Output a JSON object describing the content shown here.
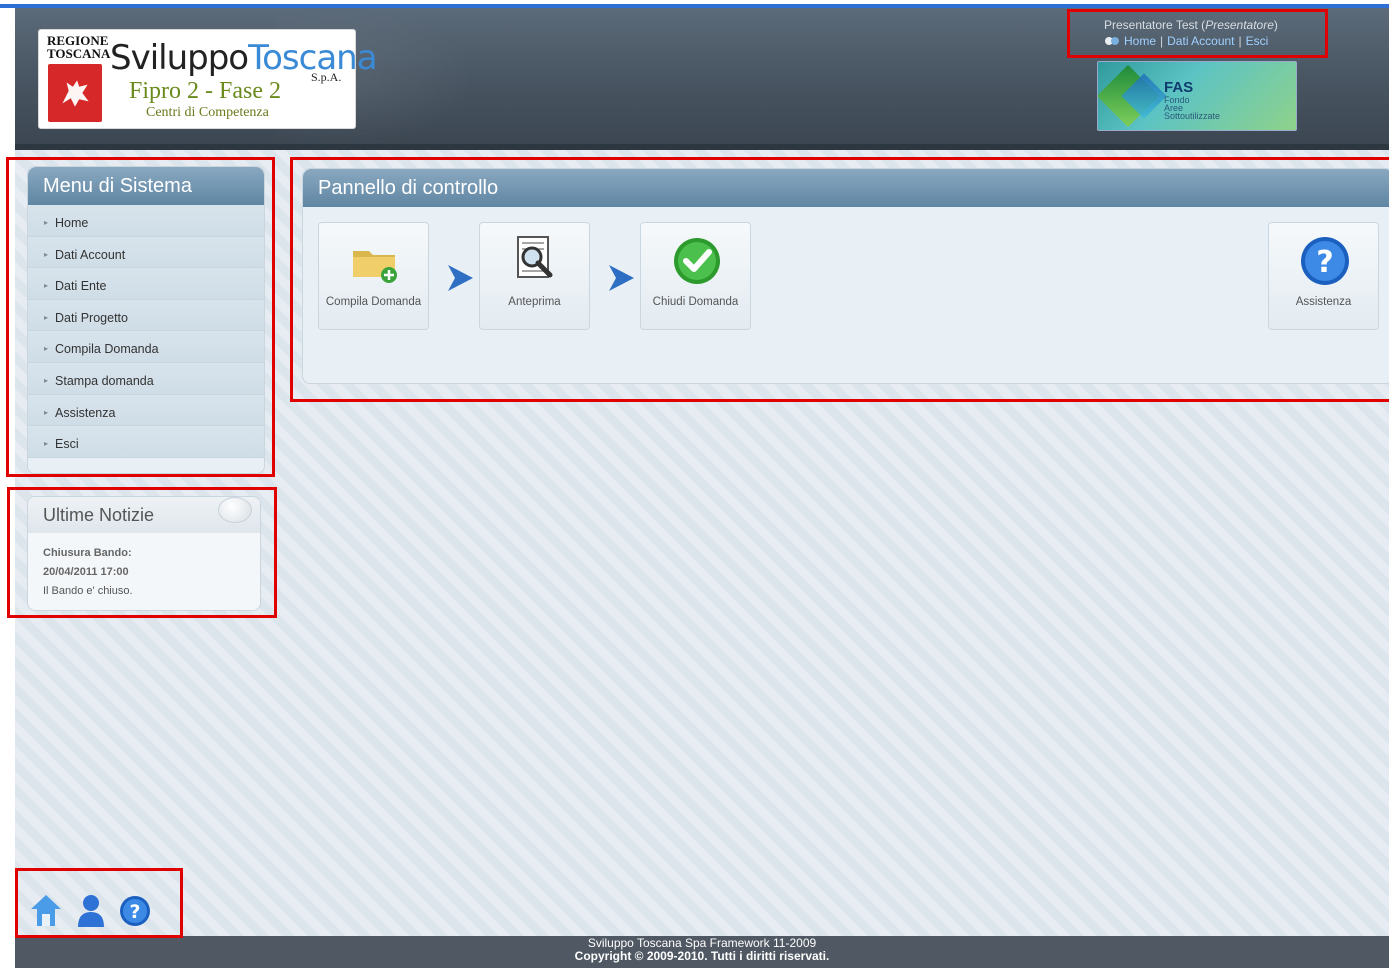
{
  "header": {
    "logo": {
      "region_line1": "REGIONE",
      "region_line2": "TOSCANA",
      "brand_part1": "Sviluppo",
      "brand_part2": "Toscana",
      "brand_suffix": "S.p.A.",
      "project": "Fipro 2 - Fase 2",
      "project_sub": "Centri di Competenza"
    },
    "user": {
      "name": "Presentatore Test",
      "role": "Presentatore",
      "links": [
        "Home",
        "Dati Account",
        "Esci"
      ]
    },
    "fas_banner": {
      "title": "FAS",
      "lines": [
        "Fondo",
        "Aree",
        "Sottoutilizzate"
      ]
    }
  },
  "menu": {
    "title": "Menu di Sistema",
    "items": [
      "Home",
      "Dati Account",
      "Dati Ente",
      "Dati Progetto",
      "Compila Domanda",
      "Stampa domanda",
      "Assistenza",
      "Esci"
    ]
  },
  "news": {
    "title": "Ultime Notizie",
    "heading": "Chiusura Bando:",
    "date": "20/04/2011 17:00",
    "text": "Il Bando e' chiuso."
  },
  "control_panel": {
    "title": "Pannello di controllo",
    "steps": [
      {
        "label": "Compila Domanda",
        "icon": "folder-add-icon"
      },
      {
        "label": "Anteprima",
        "icon": "preview-magnifier-icon"
      },
      {
        "label": "Chiudi Domanda",
        "icon": "checkmark-icon"
      }
    ],
    "help": {
      "label": "Assistenza",
      "icon": "help-icon"
    }
  },
  "bottom_icons": [
    "home-icon",
    "user-icon",
    "help-icon"
  ],
  "footer": {
    "line1": "Sviluppo Toscana Spa Framework 11-2009",
    "line2": "Copyright © 2009-2010. Tutti i diritti riservati."
  },
  "colors": {
    "header_bg": "#4a5764",
    "panel_header": "#5f86a3",
    "link": "#9fd0ff",
    "highlight": "#e00000"
  }
}
